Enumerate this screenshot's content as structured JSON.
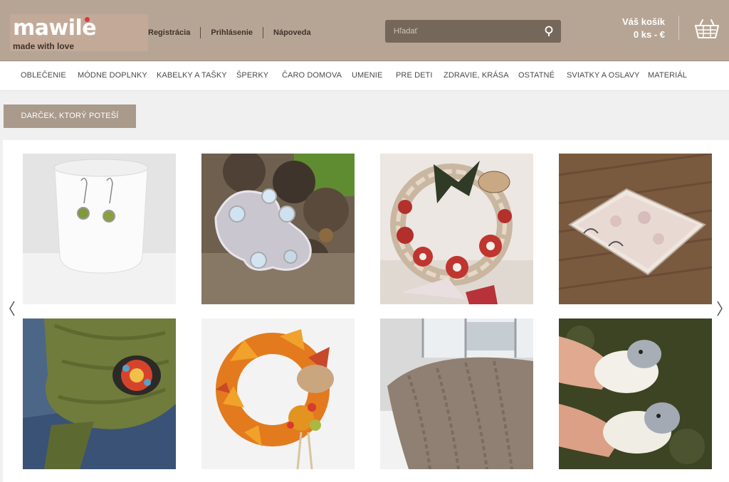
{
  "header": {
    "logo": {
      "brand": "mawile",
      "tagline": "made with love"
    },
    "links": [
      {
        "label": "Registrácia"
      },
      {
        "label": "Prihlásenie"
      },
      {
        "label": "Nápoveda"
      }
    ],
    "search": {
      "placeholder": "Hľadať",
      "icon": "search-icon"
    },
    "cart": {
      "title": "Váš košík",
      "summary": "0 ks - €",
      "icon": "basket-icon"
    }
  },
  "nav": {
    "items": [
      {
        "label": "OBLEČENIE"
      },
      {
        "label": "MÓDNE DOPLNKY"
      },
      {
        "label": "KABELKY A TAŠKY"
      },
      {
        "label": "ŠPERKY"
      },
      {
        "label": "ČARO DOMOVA"
      },
      {
        "label": "UMENIE"
      },
      {
        "label": "PRE DETI"
      },
      {
        "label": "ZDRAVIE, KRÁSA"
      },
      {
        "label": "OSTATNÉ"
      },
      {
        "label": "SVIATKY A OSLAVY"
      },
      {
        "label": "MATERIÁL"
      }
    ]
  },
  "gift": {
    "label": "DARČEK, KTORÝ POTEŠÍ"
  },
  "carousel": {
    "prev_icon": "chevron-left-icon",
    "next_icon": "chevron-right-icon",
    "products": [
      {
        "name": "product-earrings-photo"
      },
      {
        "name": "product-soutache-brooch-photo"
      },
      {
        "name": "product-flower-wreath-photo"
      },
      {
        "name": "product-notebook-photo"
      },
      {
        "name": "product-scarf-brooch-photo"
      },
      {
        "name": "product-autumn-wreath-photo"
      },
      {
        "name": "product-knit-blanket-photo"
      },
      {
        "name": "product-sheep-slippers-photo"
      }
    ]
  },
  "colors": {
    "header_bg": "#b6a595",
    "search_bg": "#76675b",
    "button_bg": "#a99a8c",
    "logo_dot": "#d9393a"
  }
}
